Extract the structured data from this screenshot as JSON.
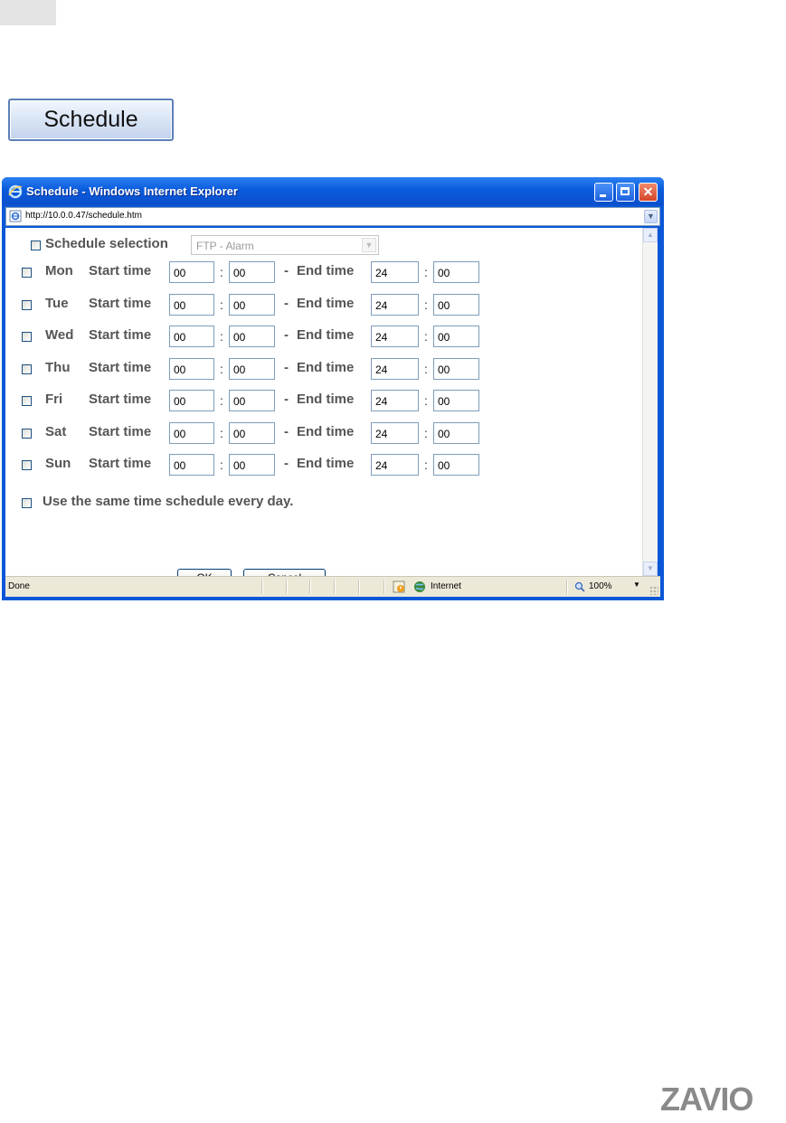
{
  "page": {
    "schedule_button_label": "Schedule",
    "logo_text": "ZAVIO"
  },
  "window": {
    "title": "Schedule - Windows Internet Explorer",
    "address": "http://10.0.0.47/schedule.htm",
    "status": {
      "left_text": "Done",
      "zone_text": "Internet",
      "zoom_text": "100%"
    }
  },
  "form": {
    "schedule_selection_label": "Schedule selection",
    "schedule_selection_value": "FTP - Alarm",
    "start_label": "Start time",
    "end_label": "End time",
    "separator_dash": "-",
    "colon": ":",
    "days": [
      {
        "name": "Mon",
        "start_h": "00",
        "start_m": "00",
        "end_h": "24",
        "end_m": "00"
      },
      {
        "name": "Tue",
        "start_h": "00",
        "start_m": "00",
        "end_h": "24",
        "end_m": "00"
      },
      {
        "name": "Wed",
        "start_h": "00",
        "start_m": "00",
        "end_h": "24",
        "end_m": "00"
      },
      {
        "name": "Thu",
        "start_h": "00",
        "start_m": "00",
        "end_h": "24",
        "end_m": "00"
      },
      {
        "name": "Fri",
        "start_h": "00",
        "start_m": "00",
        "end_h": "24",
        "end_m": "00"
      },
      {
        "name": "Sat",
        "start_h": "00",
        "start_m": "00",
        "end_h": "24",
        "end_m": "00"
      },
      {
        "name": "Sun",
        "start_h": "00",
        "start_m": "00",
        "end_h": "24",
        "end_m": "00"
      }
    ],
    "same_schedule_label": "Use the same time schedule every day.",
    "ok_label": "OK",
    "cancel_label": "Cancel"
  },
  "colors": {
    "titlebar": "#0a5bdc",
    "label_gray": "#555555",
    "button_border": "#5c7fb8"
  },
  "icons": {
    "title": "ie-logo-icon",
    "address": "page-icon",
    "zone": "globe-icon",
    "security": "warning-icon",
    "zoom": "magnifier-icon"
  }
}
